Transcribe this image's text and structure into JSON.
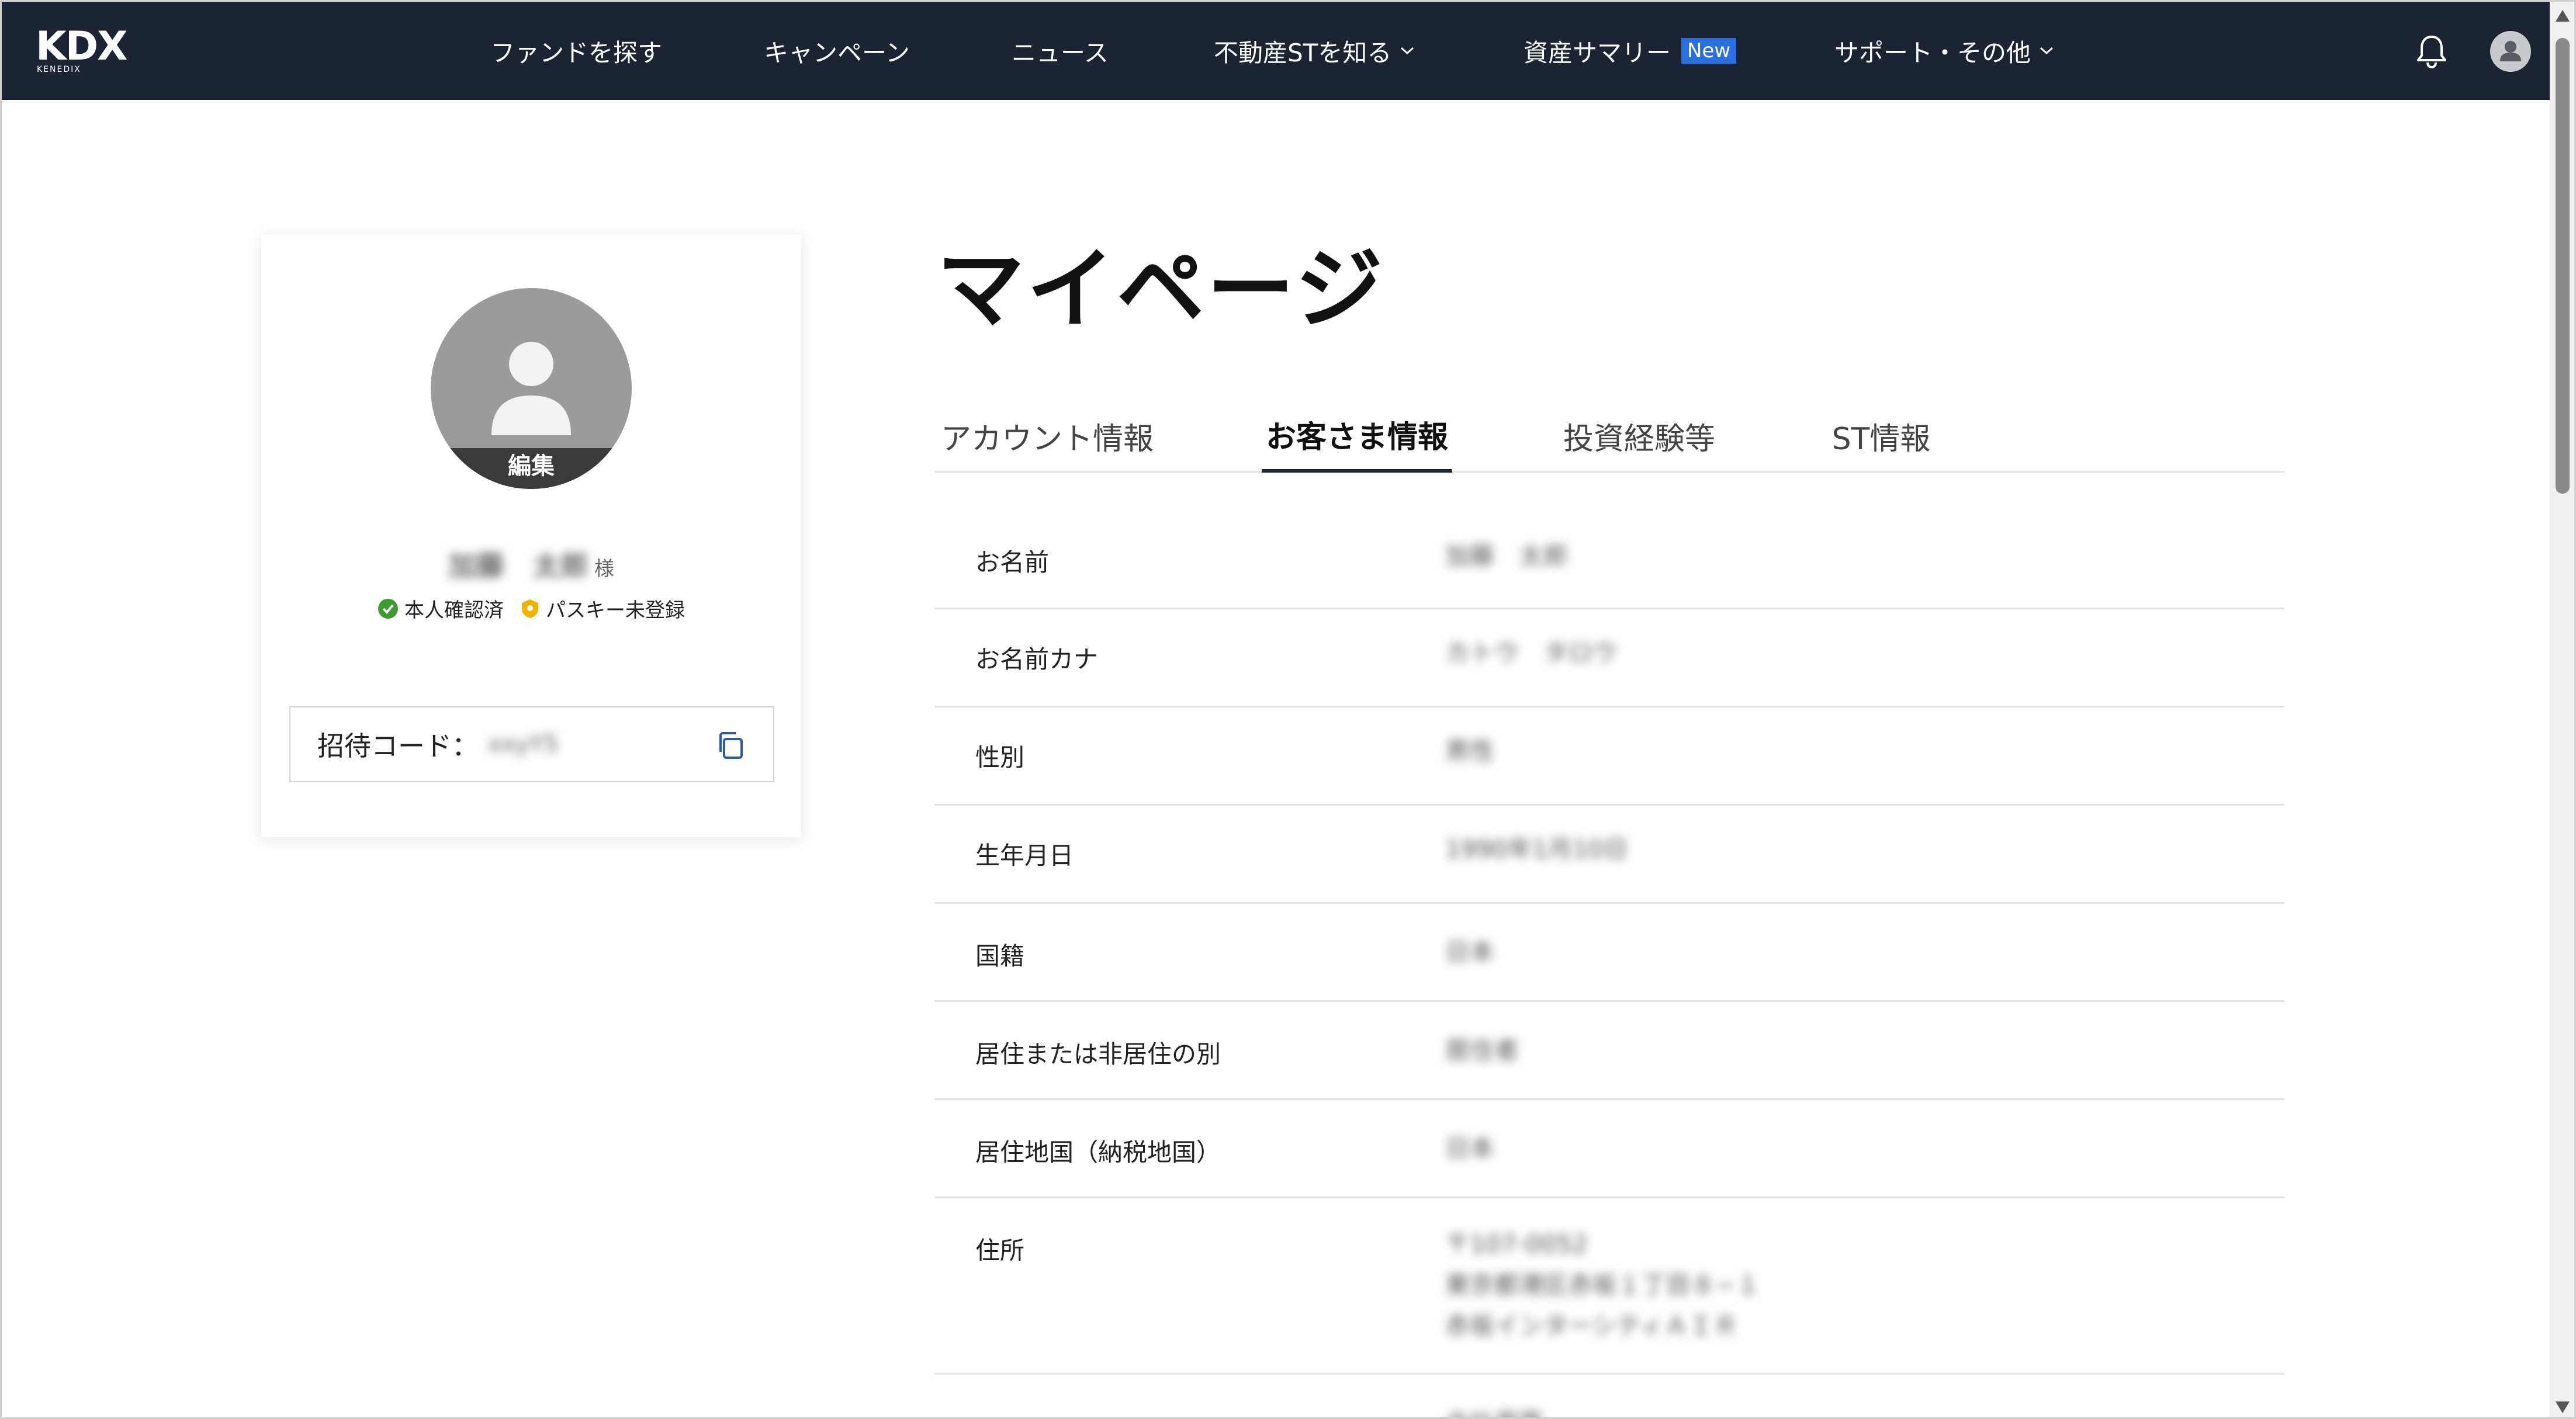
{
  "header": {
    "logo_text": "KDX",
    "logo_subtext": "KENEDIX",
    "nav": [
      {
        "label": "ファンドを探す"
      },
      {
        "label": "キャンペーン"
      },
      {
        "label": "ニュース"
      },
      {
        "label": "不動産STを知る"
      },
      {
        "label": "資産サマリー"
      },
      {
        "label": "サポート・その他"
      }
    ],
    "new_badge": "New"
  },
  "profile": {
    "name": "加藤　太郎",
    "honorific": "様",
    "avatar_edit_label": "編集",
    "badges": [
      {
        "label": "本人確認済",
        "color": "#3c9a2e"
      },
      {
        "label": "パスキー未登録",
        "color": "#f0b400"
      }
    ],
    "invite_label": "招待コード：",
    "invite_code": "xxyY5"
  },
  "page": {
    "title": "マイページ",
    "tabs": [
      {
        "label": "アカウント情報"
      },
      {
        "label": "お客さま情報"
      },
      {
        "label": "投資経験等"
      },
      {
        "label": "ST情報"
      }
    ],
    "active_tab": "お客さま情報",
    "rows": [
      {
        "label": "お名前",
        "value": "加藤　太郎"
      },
      {
        "label": "お名前カナ",
        "value": "カトウ　タロウ"
      },
      {
        "label": "性別",
        "value": "男性"
      },
      {
        "label": "生年月日",
        "value": "1990年1月10日"
      },
      {
        "label": "国籍",
        "value": "日本"
      },
      {
        "label": "居住または非居住の別",
        "value": "居住者"
      },
      {
        "label": "居住地国（納税地国）",
        "value": "日本"
      },
      {
        "label": "住所",
        "value_lines": [
          "〒107-0052",
          "東京都港区赤坂１丁目８−１",
          "赤坂インターシティＡＩＲ"
        ]
      },
      {
        "label": "",
        "value": "会社員等"
      }
    ]
  },
  "colors": {
    "nav_bg": "#1c2333",
    "accent_blue": "#2a6fe0",
    "verified_green": "#3c9a2e",
    "passkey_yellow": "#f0b400"
  }
}
